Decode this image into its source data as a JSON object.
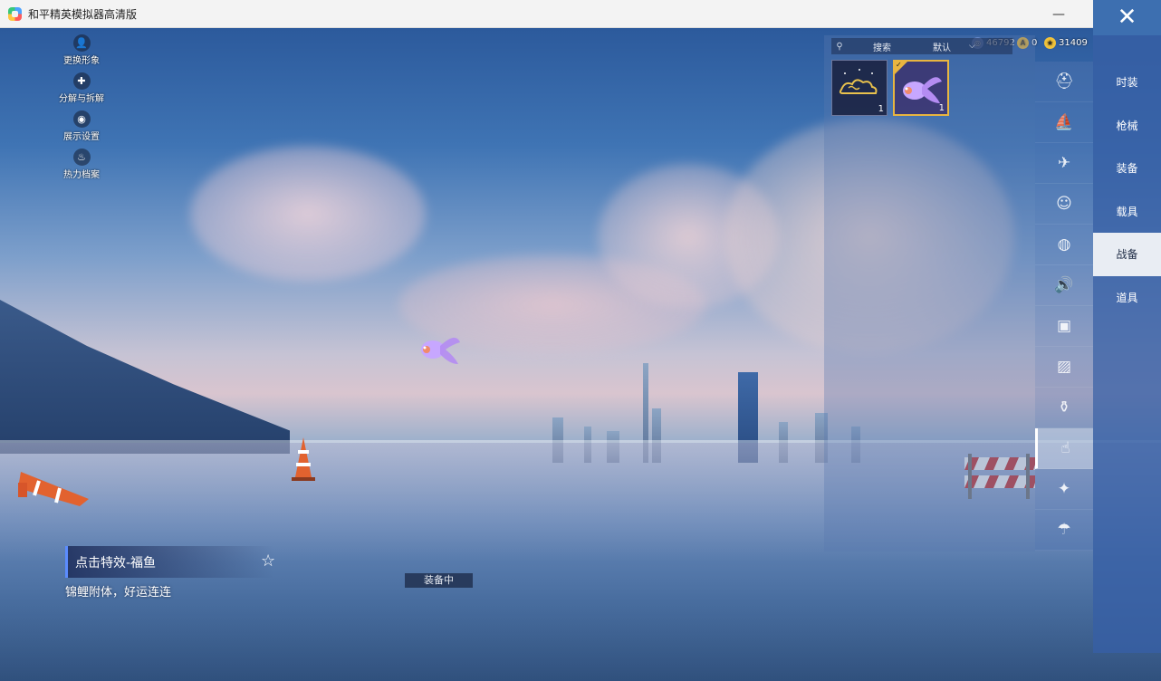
{
  "window": {
    "title": "和平精英模拟器高清版",
    "minimize_glyph": "—",
    "maximize_glyph": "☐",
    "close_glyph": "✕"
  },
  "left_menu": [
    {
      "label": "更换形象",
      "icon": "person-icon",
      "glyph": "👤"
    },
    {
      "label": "分解与拆解",
      "icon": "puzzle-icon",
      "glyph": "✚"
    },
    {
      "label": "展示设置",
      "icon": "eye-icon",
      "glyph": "◉"
    },
    {
      "label": "热力档案",
      "icon": "flame-icon",
      "glyph": "♨"
    }
  ],
  "currencies": [
    {
      "value": "46792",
      "icon": "globe-coin-icon",
      "color": "#6b8fd6",
      "glyph": "◎"
    },
    {
      "value": "0",
      "icon": "a-coin-icon",
      "color": "#e2b23a",
      "glyph": "A"
    },
    {
      "value": "31409",
      "icon": "gold-coin-icon",
      "color": "#f0c23b",
      "glyph": "★"
    }
  ],
  "close_glyph": "✕",
  "inventory": {
    "search_label": "搜索",
    "sort_label": "默认",
    "items": [
      {
        "name": "cloud-effect-item",
        "count": "1",
        "selected": false
      },
      {
        "name": "lucky-fish-item",
        "count": "1",
        "selected": true
      }
    ]
  },
  "categories": [
    {
      "icon": "helmet-icon",
      "glyph": "⛑",
      "active": false
    },
    {
      "icon": "boat-icon",
      "glyph": "⛵",
      "active": false
    },
    {
      "icon": "plane-icon",
      "glyph": "✈",
      "active": false
    },
    {
      "icon": "emote-icon",
      "glyph": "☺",
      "active": false
    },
    {
      "icon": "robot-icon",
      "glyph": "◍",
      "active": false
    },
    {
      "icon": "speaker-icon",
      "glyph": "🔊",
      "active": false
    },
    {
      "icon": "badge-icon",
      "glyph": "▣",
      "active": false
    },
    {
      "icon": "image-icon",
      "glyph": "▨",
      "active": false
    },
    {
      "icon": "spray-icon",
      "glyph": "⚱",
      "active": false
    },
    {
      "icon": "tap-effect-icon",
      "glyph": "☝",
      "active": true
    },
    {
      "icon": "magic-wand-icon",
      "glyph": "✦",
      "active": false
    },
    {
      "icon": "parachute-icon",
      "glyph": "☂",
      "active": false
    }
  ],
  "tabs": [
    {
      "label": "时装",
      "active": false
    },
    {
      "label": "枪械",
      "active": false
    },
    {
      "label": "装备",
      "active": false
    },
    {
      "label": "载具",
      "active": false
    },
    {
      "label": "战备",
      "active": true
    },
    {
      "label": "道具",
      "active": false
    }
  ],
  "selected_item": {
    "title": "点击特效-福鱼",
    "description": "锦鲤附体，好运连连",
    "status": "装备中"
  }
}
